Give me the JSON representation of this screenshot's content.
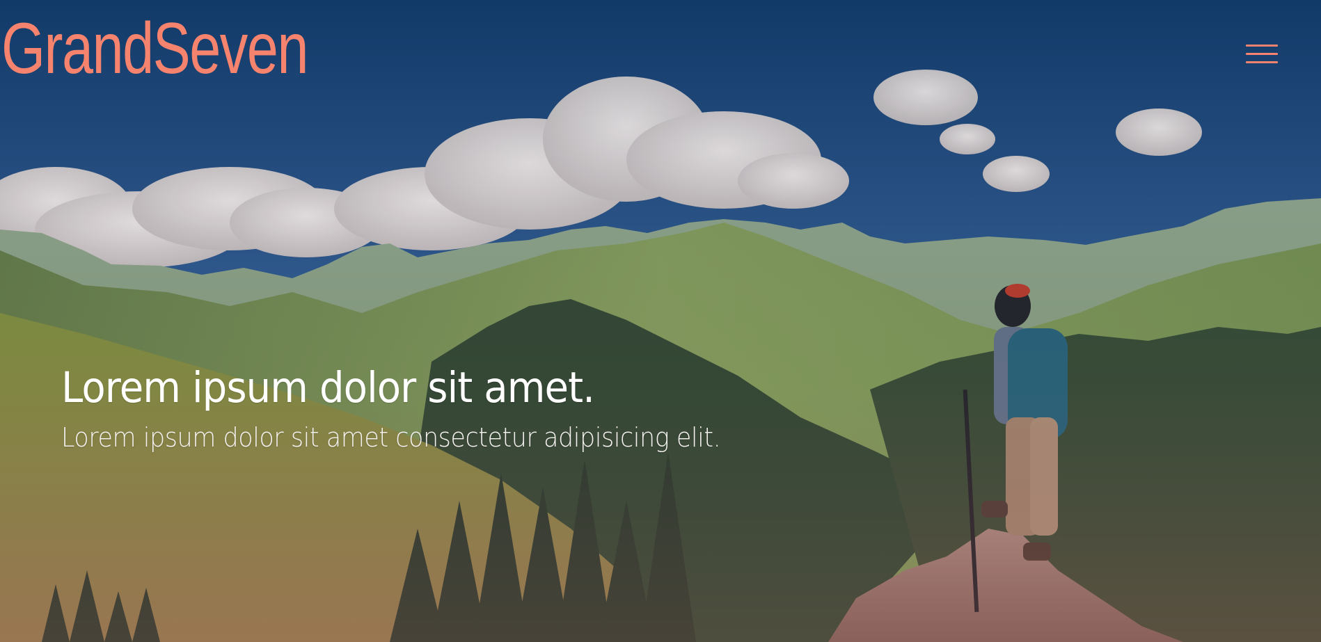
{
  "header": {
    "brand": "GrandSeven",
    "menu_icon": "hamburger-menu-icon"
  },
  "hero": {
    "headline": "Lorem ipsum dolor sit amet.",
    "subheadline": "Lorem ipsum dolor sit amet consectetur adipisicing elit."
  },
  "colors": {
    "accent": "#f6836d",
    "text": "#ffffff"
  }
}
